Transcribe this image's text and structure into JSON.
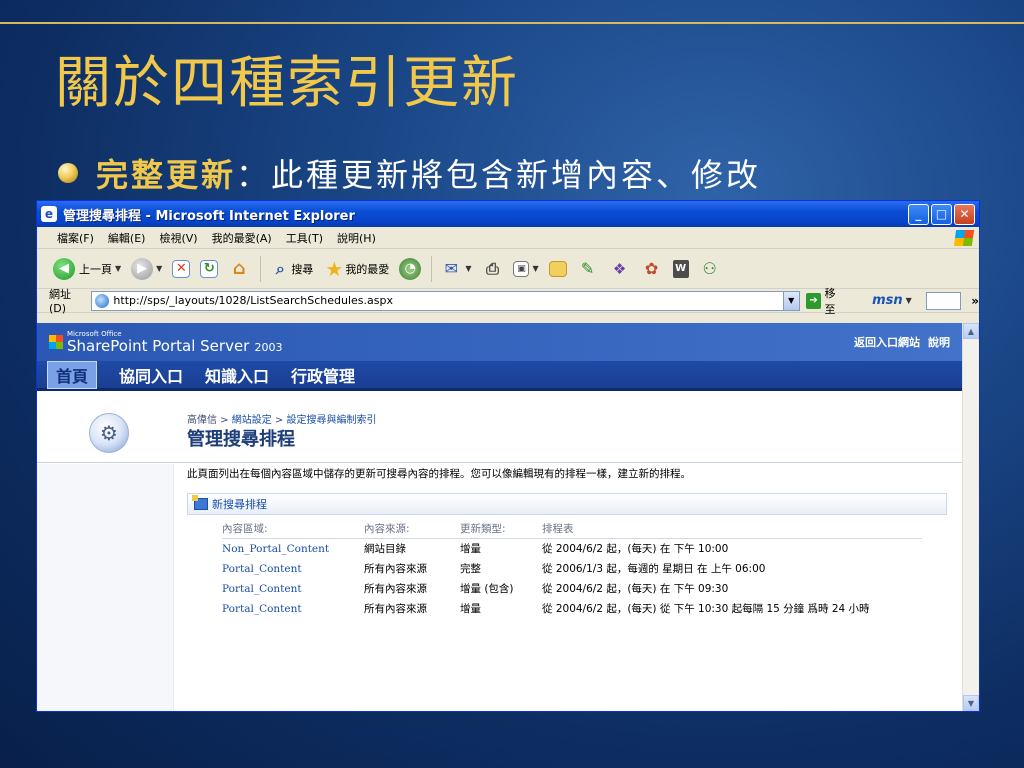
{
  "slide": {
    "title": "關於四種索引更新",
    "bullet_key": "完整更新",
    "bullet_text": "：此種更新將包含新增內容、修改"
  },
  "window": {
    "app_icon": "e",
    "title": "管理搜尋排程",
    "title_suffix": " - Microsoft Internet Explorer",
    "minimize": "_",
    "maximize": "□",
    "close": "✕"
  },
  "menu": [
    "檔案(F)",
    "編輯(E)",
    "檢視(V)",
    "我的最愛(A)",
    "工具(T)",
    "說明(H)"
  ],
  "toolbar": {
    "back": "上一頁",
    "search": "搜尋",
    "favorites": "我的最愛"
  },
  "address": {
    "label": "網址(D)",
    "url": "http://sps/_layouts/1028/ListSearchSchedules.aspx",
    "go": "移至",
    "msn": "msn"
  },
  "sps": {
    "ms_office": "Microsoft Office",
    "product": "SharePoint Portal Server",
    "year": "2003",
    "back_link": "返回入口網站",
    "help_link": "說明",
    "nav": [
      "首頁",
      "協同入口",
      "知識入口",
      "行政管理"
    ],
    "breadcrumb": [
      "高偉信",
      "網站設定",
      "設定搜尋與編制索引"
    ],
    "page_title": "管理搜尋排程",
    "description": "此頁面列出在每個內容區域中儲存的更新可搜尋內容的排程。您可以像編輯現有的排程一樣，建立新的排程。",
    "new_schedule": "新搜尋排程",
    "columns": [
      "內容區域:",
      "內容來源:",
      "更新類型:",
      "排程表"
    ],
    "rows": [
      {
        "area": "Non_Portal_Content",
        "source": "網站目錄",
        "type": "增量",
        "schedule": "從 2004/6/2 起，(每天) 在 下午 10:00"
      },
      {
        "area": "Portal_Content",
        "source": "所有內容來源",
        "type": "完整",
        "schedule": "從 2006/1/3 起，每週的 星期日 在 上午 06:00"
      },
      {
        "area": "Portal_Content",
        "source": "所有內容來源",
        "type": "增量 (包含)",
        "schedule": "從 2004/6/2 起，(每天) 在 下午 09:30"
      },
      {
        "area": "Portal_Content",
        "source": "所有內容來源",
        "type": "增量",
        "schedule": "從 2004/6/2 起，(每天) 從 下午 10:30 起每隔 15 分鐘 爲時 24 小時"
      }
    ]
  }
}
